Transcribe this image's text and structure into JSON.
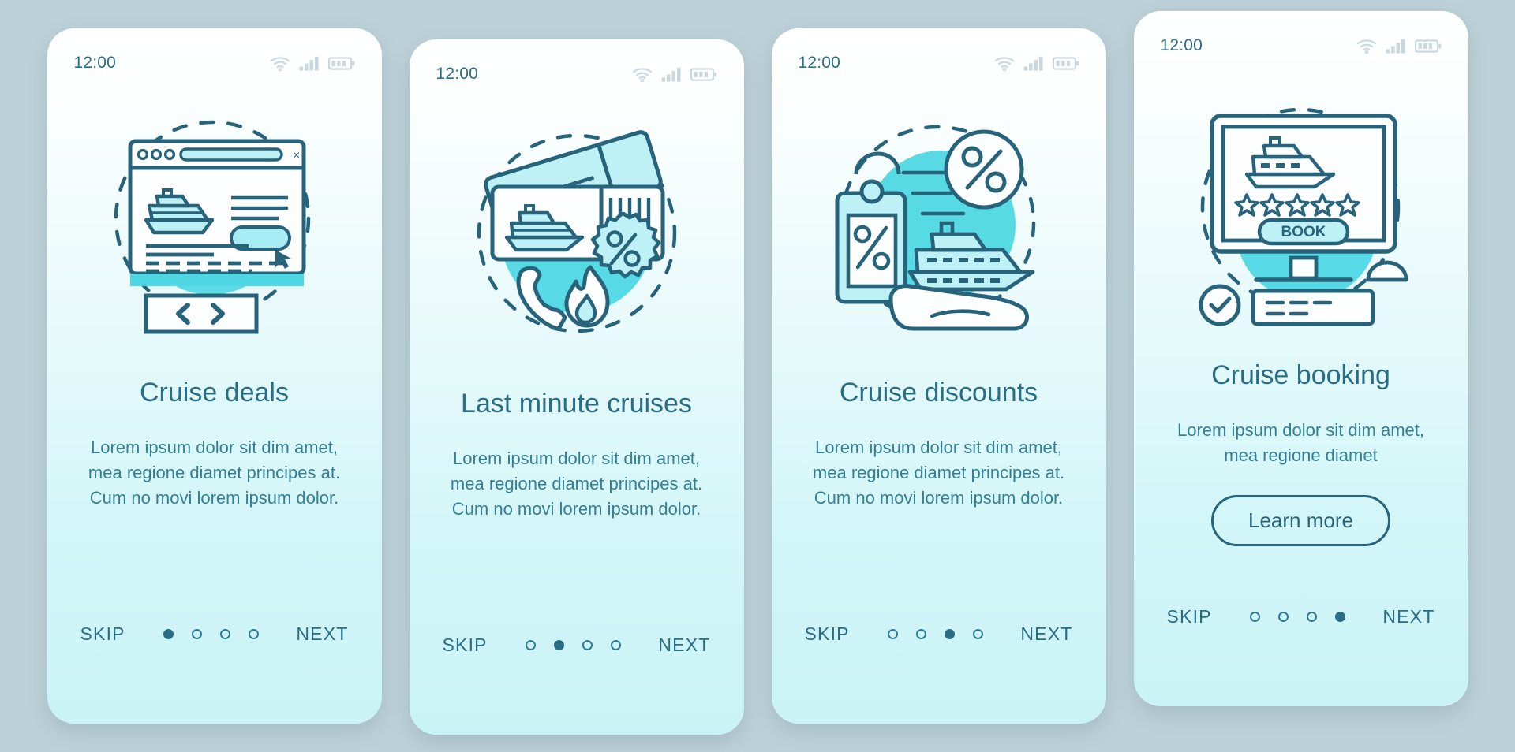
{
  "theme": {
    "page_background": "#bdd1d8",
    "card_gradient_top": "#ffffff",
    "card_gradient_bottom": "#c9f3f6",
    "accent_dark": "#2a6e86",
    "accent_line": "#27647c",
    "accent_fill": "#4fd8e4",
    "accent_light": "#bdf1f6"
  },
  "status_bar": {
    "time": "12:00",
    "icons": [
      "wifi-icon",
      "cellular-signal-icon",
      "battery-icon"
    ],
    "battery_segments": 3,
    "signal_bars": 4
  },
  "nav": {
    "skip_label": "SKIP",
    "next_label": "NEXT",
    "dot_count": 4
  },
  "screens": [
    {
      "id": "cruise-deals",
      "illustration": "browser-window-cruise-search",
      "title": "Cruise deals",
      "body": "Lorem ipsum dolor sit dim amet, mea regione diamet principes at. Cum no movi lorem ipsum dolor.",
      "active_dot": 0,
      "cta": null
    },
    {
      "id": "last-minute-cruises",
      "illustration": "ticket-phone-flame-discount",
      "title": "Last minute cruises",
      "body": "Lorem ipsum dolor sit dim amet, mea regione diamet principes at. Cum no movi lorem ipsum dolor.",
      "active_dot": 1,
      "cta": null
    },
    {
      "id": "cruise-discounts",
      "illustration": "price-tag-percent-hand-ship",
      "title": "Cruise discounts",
      "body": "Lorem ipsum dolor sit dim amet, mea regione diamet principes at. Cum no movi lorem ipsum dolor.",
      "active_dot": 2,
      "cta": null
    },
    {
      "id": "cruise-booking",
      "illustration": "desktop-monitor-rating-book",
      "title": "Cruise booking",
      "body": "Lorem ipsum dolor sit dim amet, mea regione diamet",
      "active_dot": 3,
      "cta": "Learn more",
      "book_button_label": "BOOK",
      "rating_stars": 5
    }
  ]
}
